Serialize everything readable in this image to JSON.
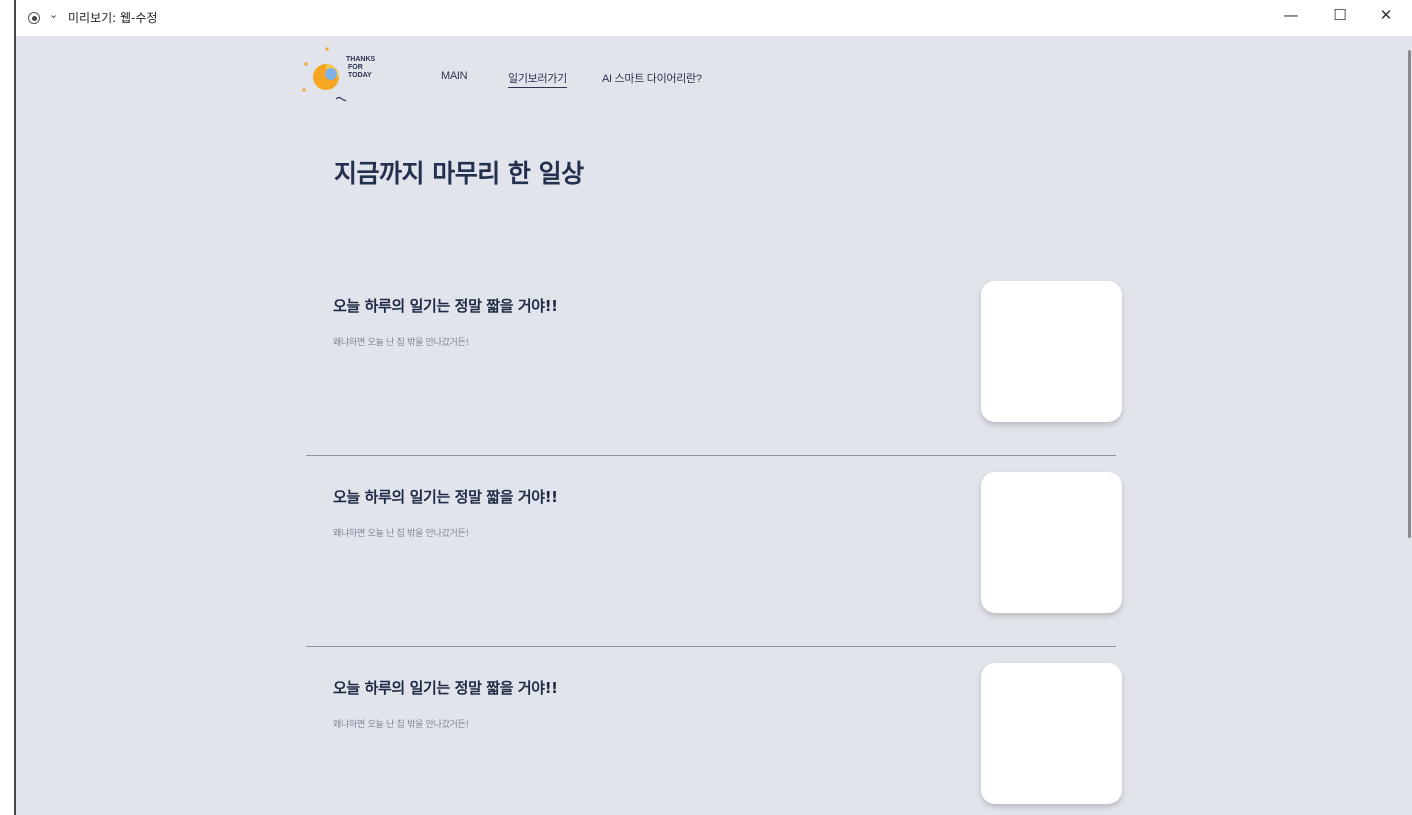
{
  "window": {
    "title": "미리보기: 웹-수정",
    "controls": {
      "minimize": "—",
      "maximize": "☐",
      "close": "✕"
    }
  },
  "logo": {
    "line1": "THANKS",
    "line2": "FOR",
    "line3": "TODAY"
  },
  "nav": [
    {
      "label": "MAIN"
    },
    {
      "label": "일기보러가기",
      "active": true
    },
    {
      "label": "AI 스마트 다이어리란?"
    }
  ],
  "page_title": "지금까지 마무리 한 일상",
  "entries": [
    {
      "title": "오늘 하루의 일기는 정말 짧을 거야!!",
      "subtitle": "왜냐하면 오늘 난 집 밖을 안나갔거든!"
    },
    {
      "title": "오늘 하루의 일기는 정말 짧을 거야!!",
      "subtitle": "왜냐하면 오늘 난 집 밖을 안나갔거든!"
    },
    {
      "title": "오늘 하루의 일기는 정말 짧을 거야!!",
      "subtitle": "왜냐하면 오늘 난 집 밖을 안나갔거든!"
    }
  ],
  "colors": {
    "background": "#e1e4eb",
    "heading": "#243050",
    "subtext": "#7d8599",
    "card": "#ffffff",
    "logo_sun": "#f5a623"
  }
}
